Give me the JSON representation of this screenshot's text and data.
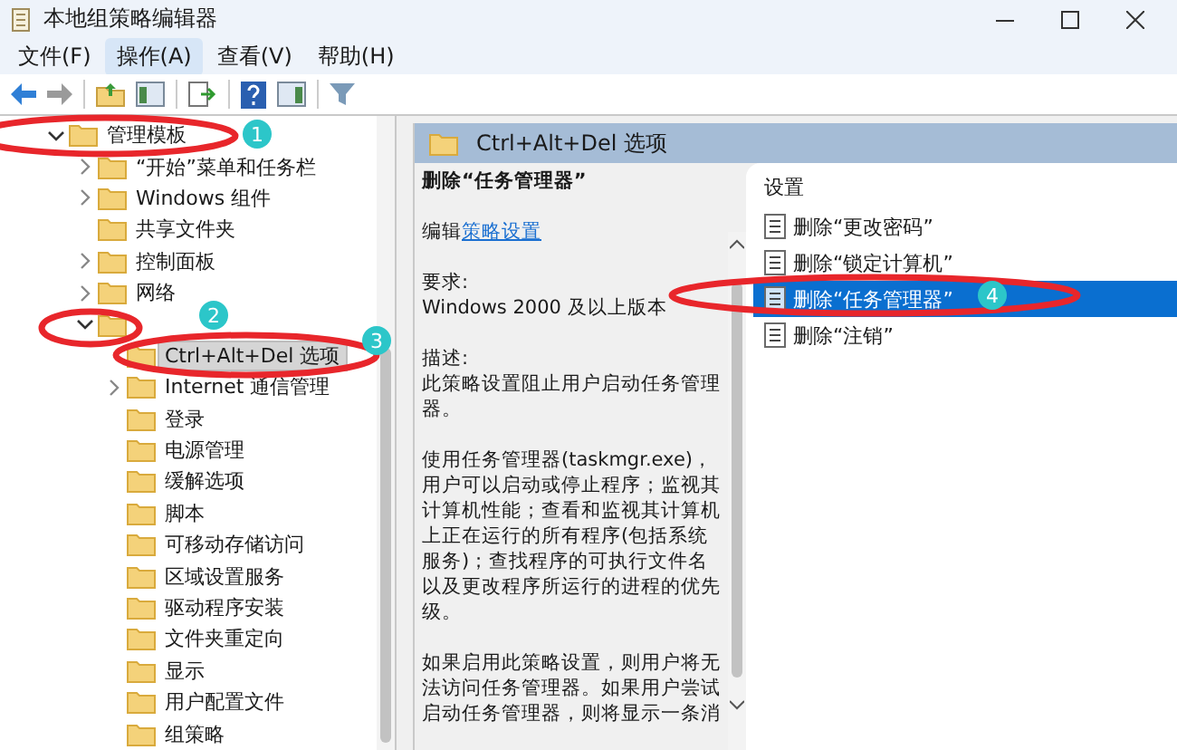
{
  "window": {
    "title": "本地组策略编辑器"
  },
  "menu": [
    {
      "label": "文件(F)",
      "selected": false
    },
    {
      "label": "操作(A)",
      "selected": true
    },
    {
      "label": "查看(V)",
      "selected": false
    },
    {
      "label": "帮助(H)",
      "selected": false
    }
  ],
  "tree": [
    {
      "label": "管理模板",
      "expandable": true,
      "expanded": true,
      "selected": false,
      "children": [
        {
          "label": "“开始”菜单和任务栏",
          "expandable": true,
          "expanded": false,
          "selected": false
        },
        {
          "label": "Windows 组件",
          "expandable": true,
          "expanded": false,
          "selected": false
        },
        {
          "label": "共享文件夹",
          "expandable": false,
          "selected": false
        },
        {
          "label": "控制面板",
          "expandable": true,
          "expanded": false,
          "selected": false
        },
        {
          "label": "网络",
          "expandable": true,
          "expanded": false,
          "selected": false
        },
        {
          "expandable": true,
          "expanded": true,
          "selected": false,
          "children": [
            {
              "label": "Ctrl+Alt+Del 选项",
              "expandable": false,
              "selected": true
            },
            {
              "label": "Internet 通信管理",
              "expandable": true,
              "expanded": false,
              "selected": false
            },
            {
              "label": "登录",
              "expandable": false,
              "selected": false
            },
            {
              "label": "电源管理",
              "expandable": false,
              "selected": false
            },
            {
              "label": "缓解选项",
              "expandable": false,
              "selected": false
            },
            {
              "label": "脚本",
              "expandable": false,
              "selected": false
            },
            {
              "label": "可移动存储访问",
              "expandable": false,
              "selected": false
            },
            {
              "label": "区域设置服务",
              "expandable": false,
              "selected": false
            },
            {
              "label": "驱动程序安装",
              "expandable": false,
              "selected": false
            },
            {
              "label": "文件夹重定向",
              "expandable": false,
              "selected": false
            },
            {
              "label": "显示",
              "expandable": false,
              "selected": false
            },
            {
              "label": "用户配置文件",
              "expandable": false,
              "selected": false
            },
            {
              "label": "组策略",
              "expandable": false,
              "selected": false
            }
          ]
        }
      ]
    }
  ],
  "header": "Ctrl+Alt+Del 选项",
  "description": {
    "title": "删除“任务管理器”",
    "edit_prefix": "编辑",
    "edit_link": "策略设置",
    "sections": [
      {
        "heading": "要求:",
        "text": "Windows 2000 及以上版本"
      },
      {
        "heading": "描述:",
        "text": "此策略设置阻止用户启动任务管理器。"
      },
      {
        "text": "使用任务管理器(taskmgr.exe)，用户可以启动或停止程序；监视其计算机性能；查看和监视其计算机上正在运行的所有程序(包括系统服务)；查找程序的可执行文件名以及更改程序所运行的进程的优先级。"
      },
      {
        "text": "如果启用此策略设置，则用户将无法访问任务管理器。如果用户尝试启动任务管理器，则将显示一条消"
      }
    ]
  },
  "settings": {
    "heading": "设置",
    "items": [
      {
        "label": "删除“更改密码”",
        "selected": false
      },
      {
        "label": "删除“锁定计算机”",
        "selected": false
      },
      {
        "label": "删除“任务管理器”",
        "selected": true
      },
      {
        "label": "删除“注销”",
        "selected": false
      }
    ]
  },
  "annotations": [
    {
      "label": "1"
    },
    {
      "label": "2"
    },
    {
      "label": "3"
    },
    {
      "label": "4"
    }
  ]
}
